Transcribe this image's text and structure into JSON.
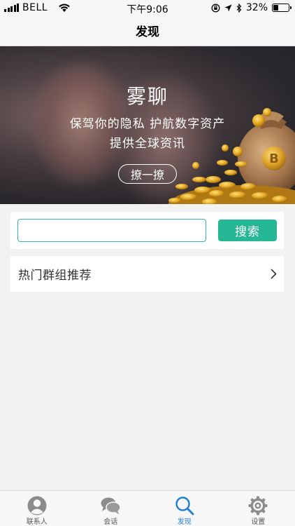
{
  "status_bar": {
    "carrier": "BELL",
    "time": "下午9:06",
    "battery": "32%",
    "battery_level": 0.32,
    "icons": [
      "signal-icon",
      "wifi-icon",
      "orientation-lock-icon",
      "location-icon",
      "bluetooth-icon",
      "battery-icon"
    ]
  },
  "nav": {
    "title": "发现"
  },
  "banner": {
    "title": "雾聊",
    "line1": "保驾你的隐私 护航数字资产",
    "line2": "提供全球资讯",
    "button_label": "撩一撩"
  },
  "search": {
    "value": "",
    "placeholder": "",
    "button_label": "搜索",
    "accent_color": "#26b894"
  },
  "hot_groups": {
    "label": "热门群组推荐",
    "icon": "chevron-right-icon"
  },
  "tab_bar": {
    "active_color": "#1f7fd6",
    "tabs": [
      {
        "label": "联系人",
        "icon": "contacts-icon",
        "active": false
      },
      {
        "label": "会话",
        "icon": "chat-bubbles-icon",
        "active": false
      },
      {
        "label": "发现",
        "icon": "search-icon",
        "active": true
      },
      {
        "label": "设置",
        "icon": "gear-icon",
        "active": false
      }
    ]
  }
}
